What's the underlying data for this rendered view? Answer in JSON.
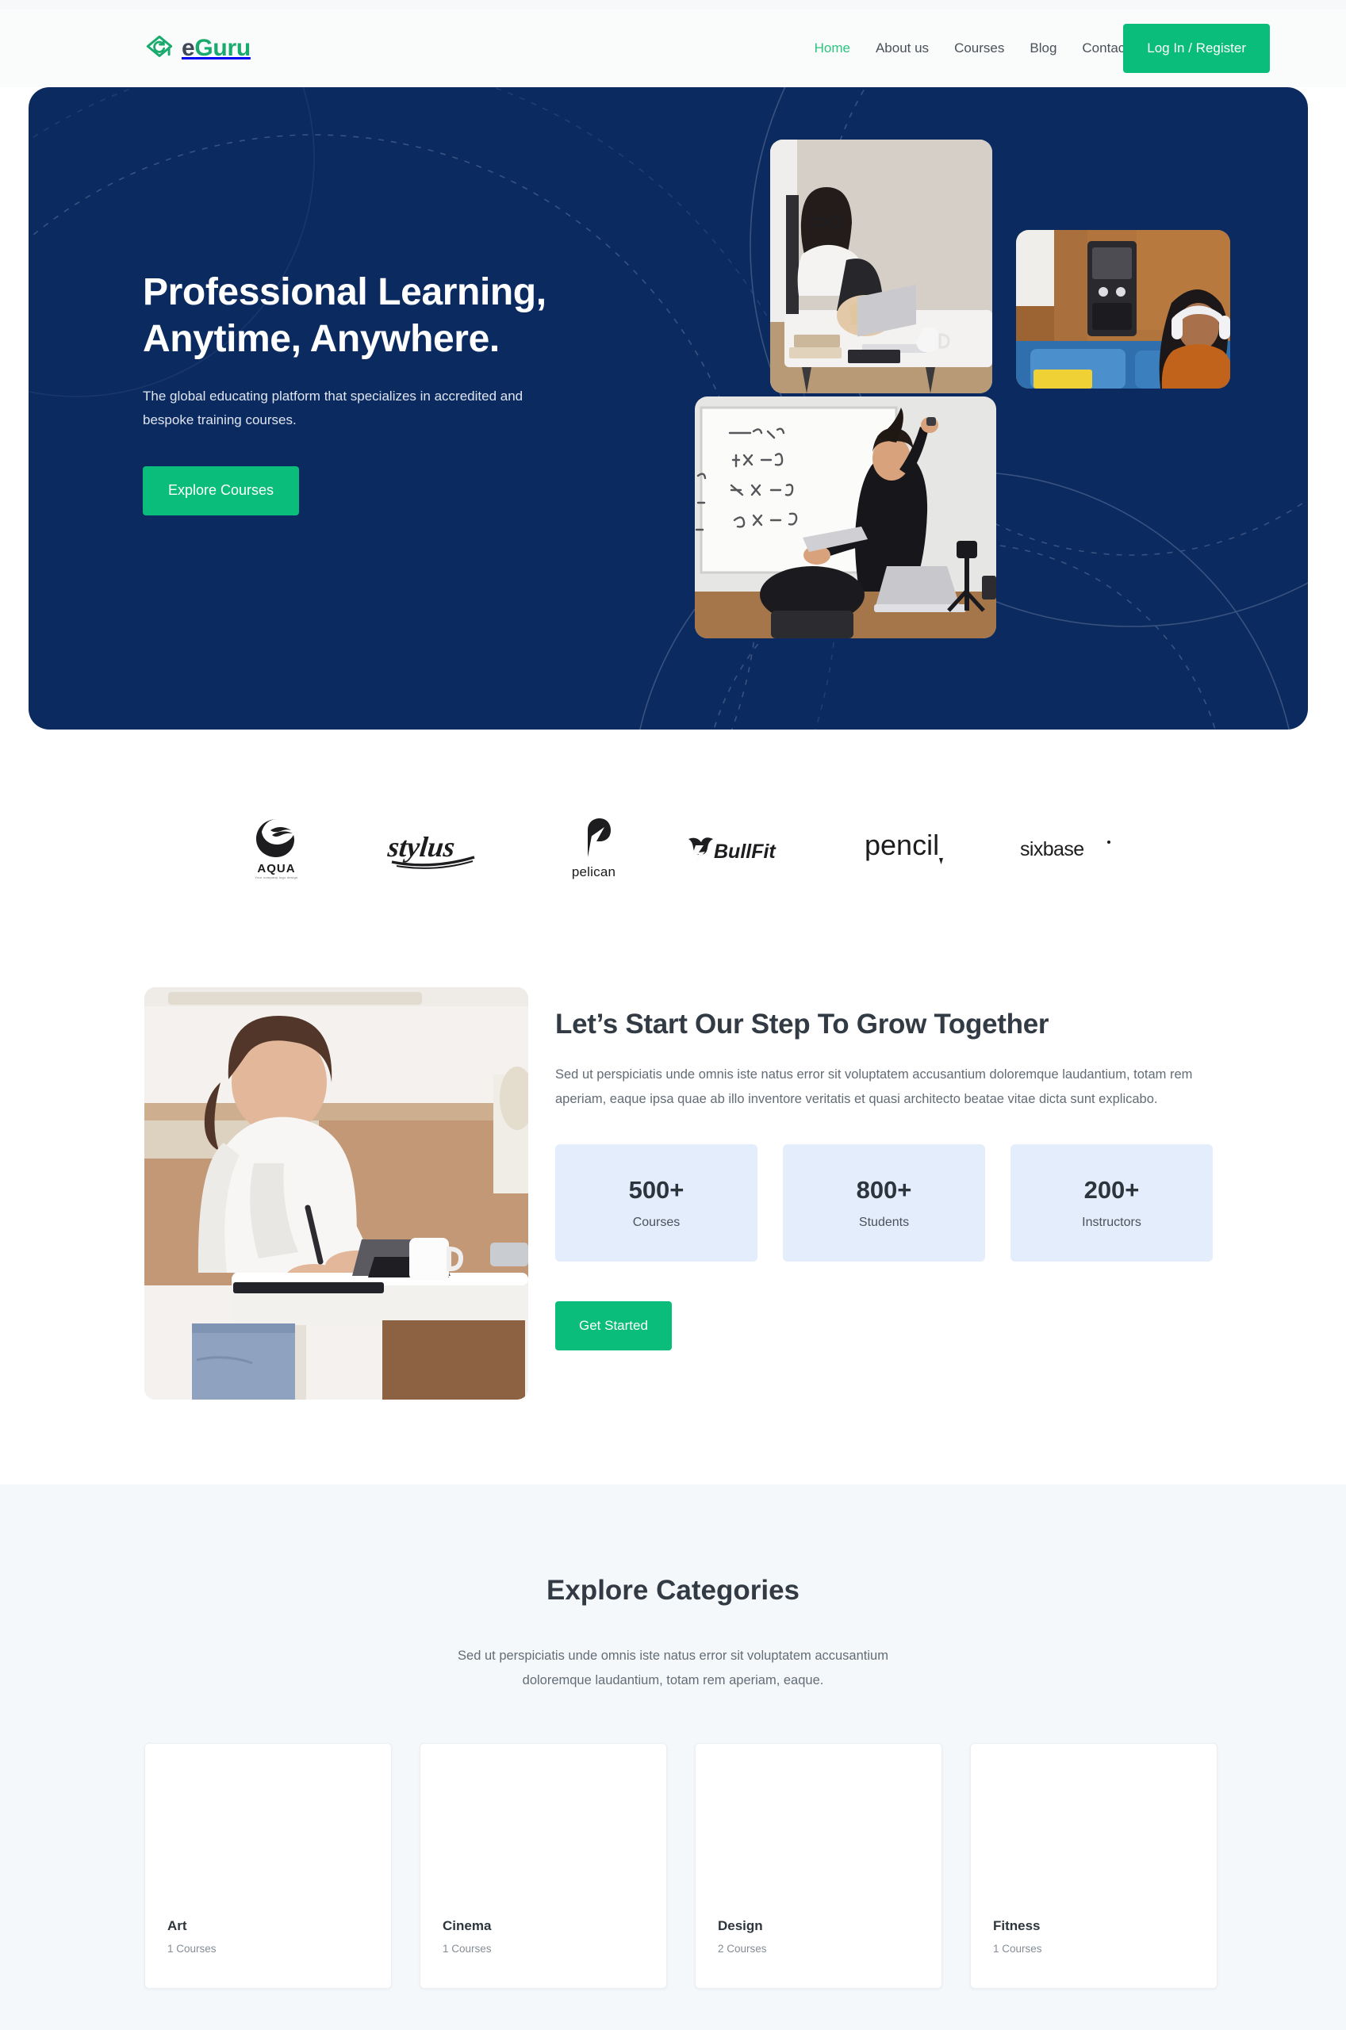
{
  "brand": {
    "logo_icon": "graduation-cap-refresh-icon",
    "name_part1": "e",
    "name_part2": "Guru",
    "accent_color": "#19ab6e",
    "dark_color": "#3f4a56"
  },
  "nav": {
    "items": [
      {
        "label": "Home",
        "active": true
      },
      {
        "label": "About us",
        "active": false
      },
      {
        "label": "Courses",
        "active": false
      },
      {
        "label": "Blog",
        "active": false
      },
      {
        "label": "Contact",
        "active": false
      }
    ],
    "login_label": "Log In / Register",
    "button_color": "#0bbd7a"
  },
  "hero": {
    "background_color": "#0b2a60",
    "title": "Professional Learning,\nAnytime, Anywhere.",
    "subtitle": "The global educating platform that specializes in accredited and\nbespoke training courses.",
    "cta_label": "Explore Courses",
    "images": [
      {
        "alt": "woman-studying-at-desk-with-laptop"
      },
      {
        "alt": "woman-with-headphones-on-couch-with-laptop"
      },
      {
        "alt": "teacher-writing-equations-on-whiteboard"
      }
    ]
  },
  "brands": {
    "items": [
      {
        "name": "AQUA",
        "tagline": "Your company logo design"
      },
      {
        "name": "stylus",
        "tagline": ""
      },
      {
        "name": "pelican",
        "tagline": ""
      },
      {
        "name": "BullFit",
        "tagline": ""
      },
      {
        "name": "pencil",
        "tagline": ""
      },
      {
        "name": "sixbase",
        "tagline": ""
      }
    ]
  },
  "grow": {
    "image_alt": "woman-writing-notes-beside-laptop-on-table",
    "title": "Let’s Start Our Step To Grow Together",
    "paragraph": "Sed ut perspiciatis unde omnis iste natus error sit voluptatem accusantium doloremque laudantium, totam rem aperiam, eaque ipsa quae ab illo inventore veritatis et quasi architecto beatae vitae dicta sunt explicabo.",
    "stats": [
      {
        "value": "500+",
        "label": "Courses"
      },
      {
        "value": "800+",
        "label": "Students"
      },
      {
        "value": "200+",
        "label": "Instructors"
      }
    ],
    "cta_label": "Get Started",
    "stat_bg_color": "#e4edfb"
  },
  "categories": {
    "section_bg_color": "#f4f8fb",
    "title": "Explore Categories",
    "subtitle": "Sed ut perspiciatis unde omnis iste natus error sit voluptatem accusantium\ndoloremque laudantium, totam rem aperiam, eaque.",
    "cards": [
      {
        "name": "Art",
        "count": "1 Courses"
      },
      {
        "name": "Cinema",
        "count": "1 Courses"
      },
      {
        "name": "Design",
        "count": "2 Courses"
      },
      {
        "name": "Fitness",
        "count": "1 Courses"
      }
    ]
  }
}
